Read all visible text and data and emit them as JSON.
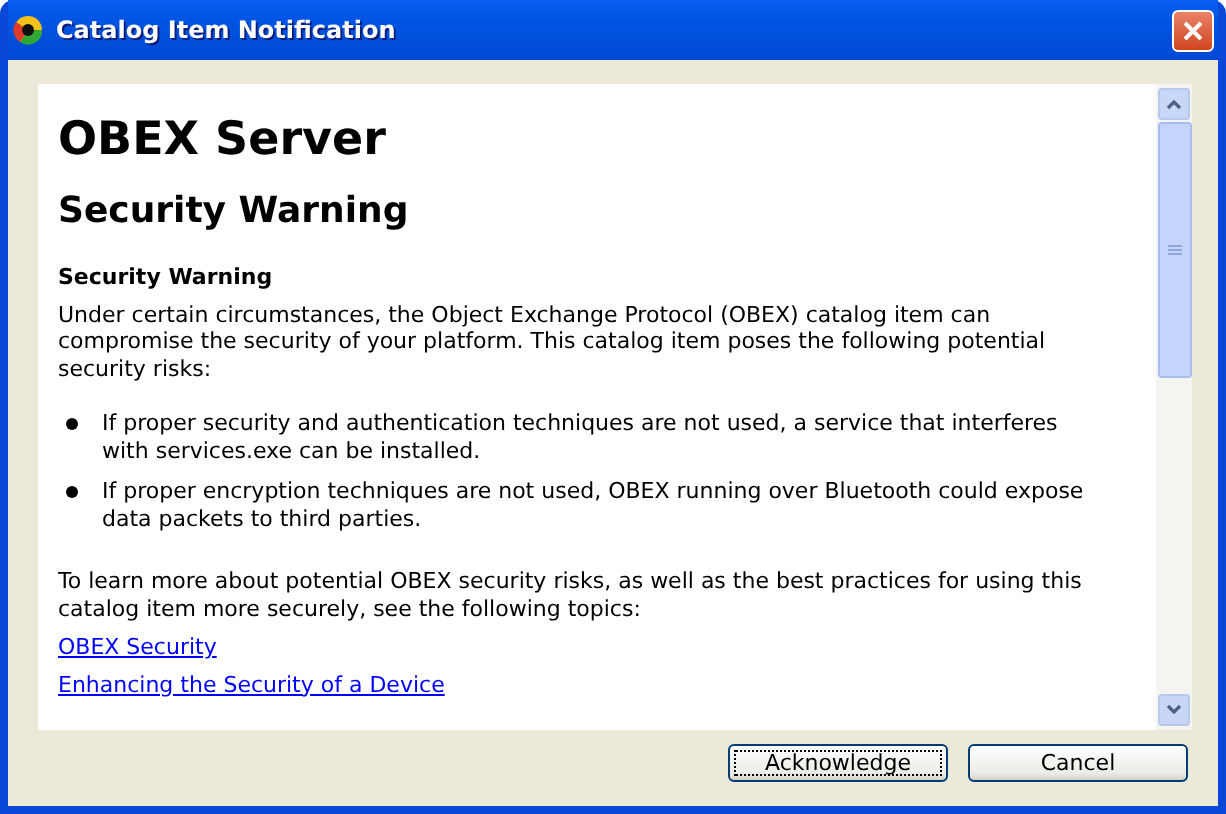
{
  "window": {
    "title": "Catalog Item Notification"
  },
  "document": {
    "title": "OBEX Server",
    "subtitle": "Security Warning",
    "section_heading": "Security Warning",
    "intro": "Under certain circumstances, the Object Exchange Protocol (OBEX) catalog item can compromise the security of your platform. This catalog item poses the following potential security risks:",
    "bullets": [
      "If proper security and authentication techniques are not used, a service that interferes with services.exe can be installed.",
      "If proper encryption techniques are not used, OBEX running over Bluetooth could expose data packets to third parties."
    ],
    "outro": "To learn more about potential OBEX security risks, as well as the best practices for using this catalog item more securely, see the following topics:",
    "links": [
      "OBEX Security",
      "Enhancing the Security of a Device"
    ]
  },
  "buttons": [
    {
      "label": "Acknowledge",
      "focused": true
    },
    {
      "label": "Cancel",
      "focused": false
    }
  ]
}
